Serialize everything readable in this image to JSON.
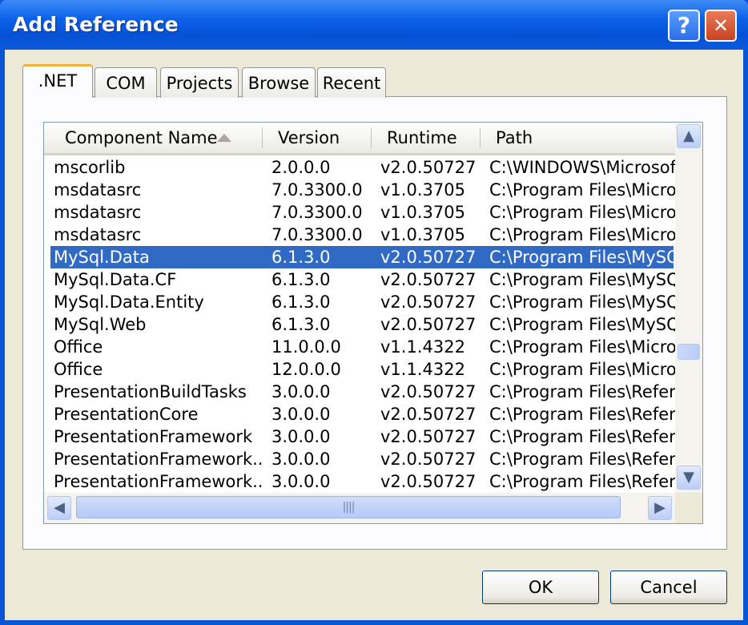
{
  "window": {
    "title": "Add Reference",
    "help_glyph": "?",
    "close_glyph": "✕"
  },
  "tabs": [
    {
      "label": ".NET",
      "active": true
    },
    {
      "label": "COM",
      "active": false
    },
    {
      "label": "Projects",
      "active": false
    },
    {
      "label": "Browse",
      "active": false
    },
    {
      "label": "Recent",
      "active": false
    }
  ],
  "columns": [
    "Component Name",
    "Version",
    "Runtime",
    "Path"
  ],
  "rows": [
    {
      "name": "mscorlib",
      "version": "2.0.0.0",
      "runtime": "v2.0.50727",
      "path": "C:\\WINDOWS\\Microsof..."
    },
    {
      "name": "msdatasrc",
      "version": "7.0.3300.0",
      "runtime": "v1.0.3705",
      "path": "C:\\Program Files\\Micro..."
    },
    {
      "name": "msdatasrc",
      "version": "7.0.3300.0",
      "runtime": "v1.0.3705",
      "path": "C:\\Program Files\\Micro..."
    },
    {
      "name": "msdatasrc",
      "version": "7.0.3300.0",
      "runtime": "v1.0.3705",
      "path": "C:\\Program Files\\Micro..."
    },
    {
      "name": "MySql.Data",
      "version": "6.1.3.0",
      "runtime": "v2.0.50727",
      "path": "C:\\Program Files\\MySQ...",
      "selected": true
    },
    {
      "name": "MySql.Data.CF",
      "version": "6.1.3.0",
      "runtime": "v2.0.50727",
      "path": "C:\\Program Files\\MySQ..."
    },
    {
      "name": "MySql.Data.Entity",
      "version": "6.1.3.0",
      "runtime": "v2.0.50727",
      "path": "C:\\Program Files\\MySQ..."
    },
    {
      "name": "MySql.Web",
      "version": "6.1.3.0",
      "runtime": "v2.0.50727",
      "path": "C:\\Program Files\\MySQ..."
    },
    {
      "name": "Office",
      "version": "11.0.0.0",
      "runtime": "v1.1.4322",
      "path": "C:\\Program Files\\Micro..."
    },
    {
      "name": "Office",
      "version": "12.0.0.0",
      "runtime": "v1.1.4322",
      "path": "C:\\Program Files\\Micro..."
    },
    {
      "name": "PresentationBuildTasks",
      "version": "3.0.0.0",
      "runtime": "v2.0.50727",
      "path": "C:\\Program Files\\Refer..."
    },
    {
      "name": "PresentationCore",
      "version": "3.0.0.0",
      "runtime": "v2.0.50727",
      "path": "C:\\Program Files\\Refer..."
    },
    {
      "name": "PresentationFramework",
      "version": "3.0.0.0",
      "runtime": "v2.0.50727",
      "path": "C:\\Program Files\\Refer..."
    },
    {
      "name": "PresentationFramework...",
      "version": "3.0.0.0",
      "runtime": "v2.0.50727",
      "path": "C:\\Program Files\\Refer..."
    },
    {
      "name": "PresentationFramework...",
      "version": "3.0.0.0",
      "runtime": "v2.0.50727",
      "path": "C:\\Program Files\\Refer..."
    }
  ],
  "scroll": {
    "up": "▲",
    "down": "▼",
    "left": "◀",
    "right": "▶",
    "grip": "||||"
  },
  "buttons": {
    "ok": "OK",
    "cancel": "Cancel"
  },
  "colors": {
    "title_bar": "#0a5fe8",
    "selection": "#316ac5",
    "dialog_face": "#ece9d8"
  }
}
